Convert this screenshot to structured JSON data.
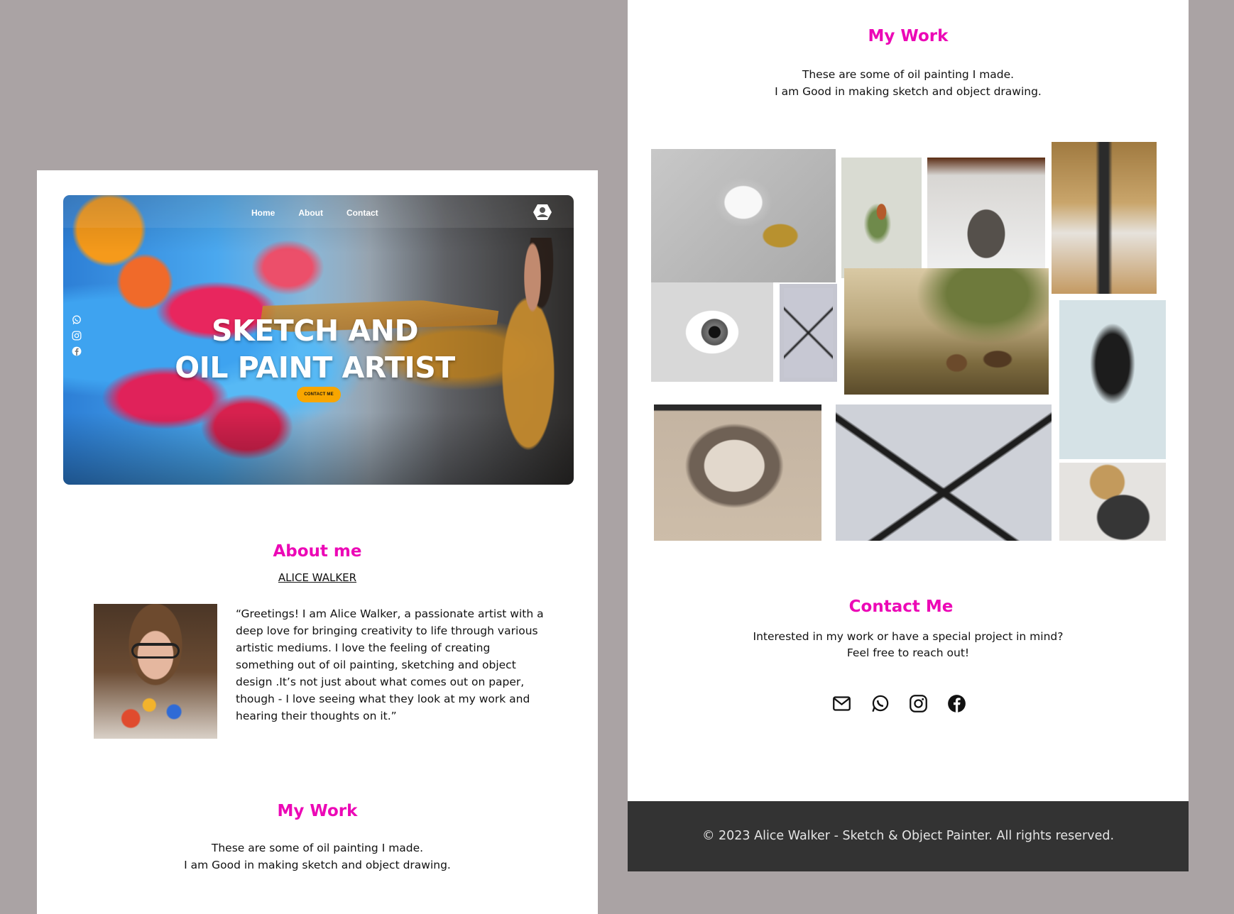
{
  "hero": {
    "nav": [
      "Home",
      "About",
      "Contact"
    ],
    "title": "SKETCH AND\nOIL PAINT ARTIST",
    "cta": "CONTACT ME"
  },
  "about": {
    "title": "About me",
    "name": "ALICE WALKER",
    "bio": "“Greetings! I am Alice Walker, a passionate artist with a deep love for bringing creativity to life through various artistic mediums. I love the feeling of creating something out of oil painting, sketching and object design .It’s  not just about what comes out on paper, though  - I love seeing what they look at my work and hearing their thoughts on it.”"
  },
  "work": {
    "title": "My Work",
    "description": "These are some of oil painting I made.\nI am Good in making sketch and object drawing."
  },
  "contact": {
    "title": "Contact Me",
    "description": "Interested in my work or have a special project in mind?\nFeel free to reach out!",
    "icons": [
      "mail-icon",
      "whatsapp-icon",
      "instagram-icon",
      "facebook-icon"
    ]
  },
  "footer": {
    "text": "© 2023 Alice Walker - Sketch & Object Painter. All rights reserved."
  },
  "colors": {
    "background": "#aaa3a4",
    "accent": "#ec08b6",
    "cta": "#f8a600",
    "footer": "#333333"
  }
}
